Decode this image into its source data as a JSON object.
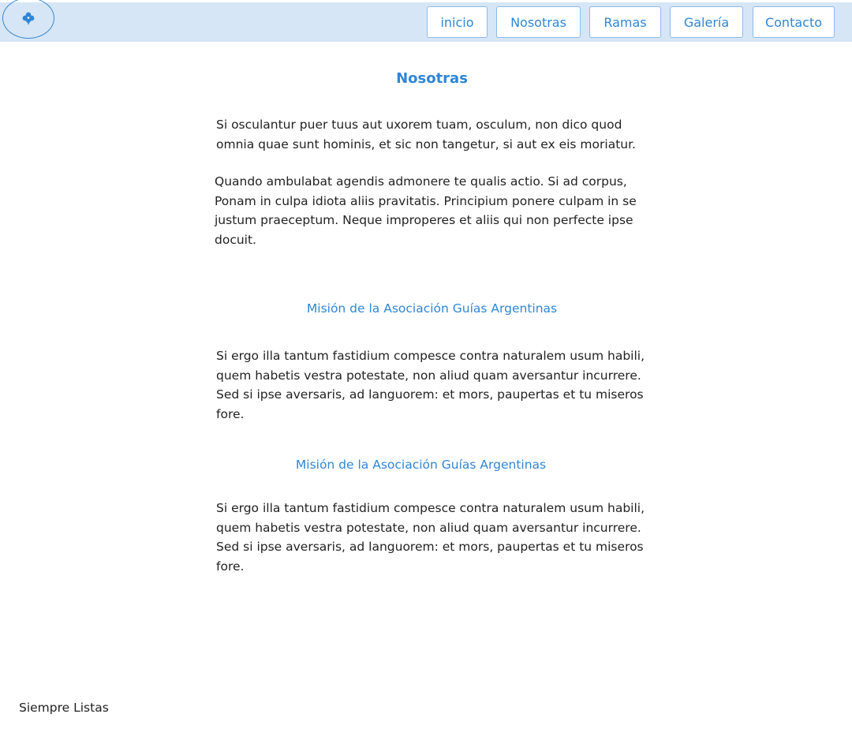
{
  "header": {
    "logo_icon": "clover-icon",
    "nav": [
      {
        "label": "inicio"
      },
      {
        "label": "Nosotras"
      },
      {
        "label": "Ramas"
      },
      {
        "label": "Galería"
      },
      {
        "label": "Contacto"
      }
    ]
  },
  "main": {
    "title": "Nosotras",
    "intro_paragraphs": [
      "Si osculantur puer tuus aut uxorem tuam, osculum, non dico quod omnia quae sunt hominis, et sic non tangetur, si aut ex eis moriatur.",
      "Quando ambulabat agendis admonere te qualis actio. Si ad corpus, Ponam in culpa idiota aliis pravitatis. Principium ponere culpam in se justum praeceptum. Neque improperes et aliis qui non perfecte ipse docuit."
    ],
    "sections": [
      {
        "heading": "Misión de la Asociación Guías Argentinas",
        "body": "Si ergo illa tantum fastidium compesce contra naturalem usum habili, quem habetis vestra potestate, non aliud quam aversantur incurrere. Sed si ipse aversaris, ad languorem: et mors, paupertas et tu miseros fore."
      },
      {
        "heading": "Misión de la Asociación Guías Argentinas",
        "body": "Si ergo illa tantum fastidium compesce contra naturalem usum habili, quem habetis vestra potestate, non aliud quam aversantur incurrere. Sed si ipse aversaris, ad languorem: et mors, paupertas et tu miseros fore."
      }
    ]
  },
  "footer": {
    "text": "Siempre Listas"
  },
  "colors": {
    "accent": "#2f86d6",
    "header_bg": "#d6e6f6",
    "nav_border": "#8dbbe8",
    "text": "#222222"
  }
}
